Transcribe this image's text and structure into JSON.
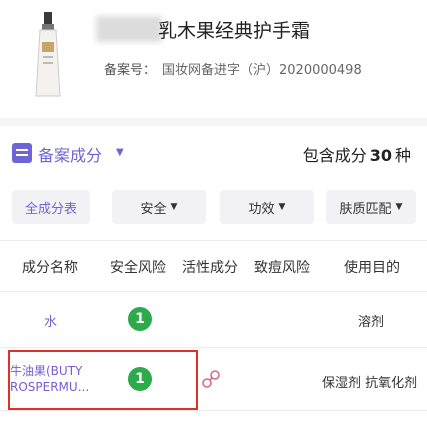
{
  "product": {
    "name": "乳木果经典护手霜",
    "registration_label": "备案号：",
    "registration_value": "国妆网备进字（沪）2020000498"
  },
  "section": {
    "icon": "document-list-icon",
    "title": "备案成分",
    "total_prefix": "包含成分",
    "total_count": "30",
    "total_suffix": "种"
  },
  "tabs": [
    {
      "label": "全成分表",
      "active": true
    },
    {
      "label": "安全"
    },
    {
      "label": "功效"
    },
    {
      "label": "肤质匹配"
    }
  ],
  "table": {
    "headers": [
      "成分名称",
      "安全风险",
      "活性成分",
      "致痘风险",
      "使用目的"
    ],
    "rows": [
      {
        "name": "水",
        "safety": "1",
        "purpose": "溶剂"
      },
      {
        "name_line1": "牛油果(BUTY",
        "name_line2": "ROSPERMU...",
        "safety": "1",
        "active_icon": "link-icon",
        "purpose": "保湿剂 抗氧化剂"
      }
    ]
  },
  "colors": {
    "accent": "#6f64d6",
    "safe": "#2daa4c",
    "highlight": "#e0302a"
  }
}
